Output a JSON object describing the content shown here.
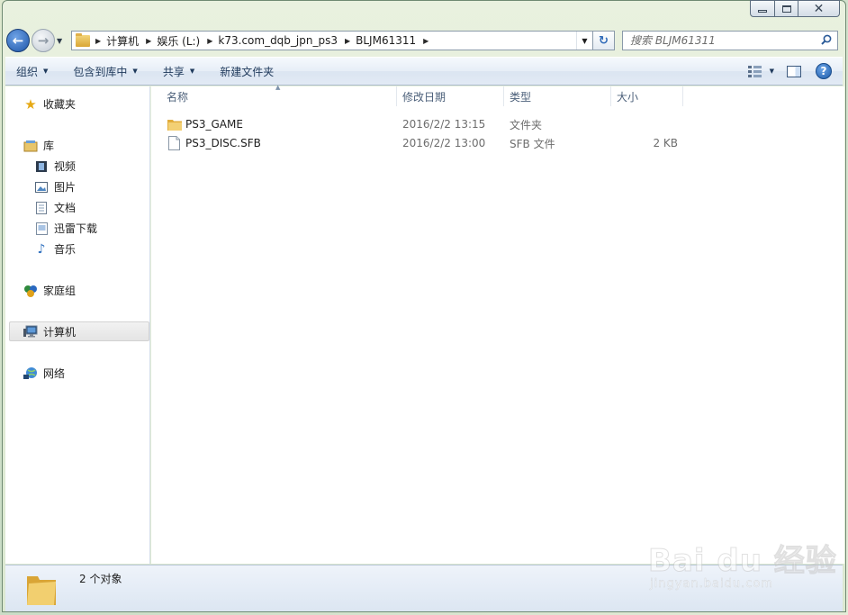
{
  "address": {
    "crumbs": [
      "计算机",
      "娱乐 (L:)",
      "k73.com_dqb_jpn_ps3",
      "BLJM61311"
    ]
  },
  "search": {
    "placeholder": "搜索 BLJM61311"
  },
  "commands": {
    "organize": "组织",
    "include_in_library": "包含到库中",
    "share": "共享",
    "new_folder": "新建文件夹"
  },
  "sidebar": {
    "favorites": "收藏夹",
    "libraries": "库",
    "library_items": [
      "视频",
      "图片",
      "文档",
      "迅雷下载",
      "音乐"
    ],
    "homegroup": "家庭组",
    "computer": "计算机",
    "network": "网络"
  },
  "columns": {
    "name": "名称",
    "date": "修改日期",
    "type": "类型",
    "size": "大小"
  },
  "files": [
    {
      "name": "PS3_GAME",
      "date": "2016/2/2 13:15",
      "type": "文件夹",
      "size": "",
      "icon": "folder-icon"
    },
    {
      "name": "PS3_DISC.SFB",
      "date": "2016/2/2 13:00",
      "type": "SFB 文件",
      "size": "2 KB",
      "icon": "file-icon"
    }
  ],
  "status": {
    "count": "2 个对象"
  },
  "watermark": {
    "brand": "Bai du 经验",
    "url": "jingyan.baidu.com"
  }
}
